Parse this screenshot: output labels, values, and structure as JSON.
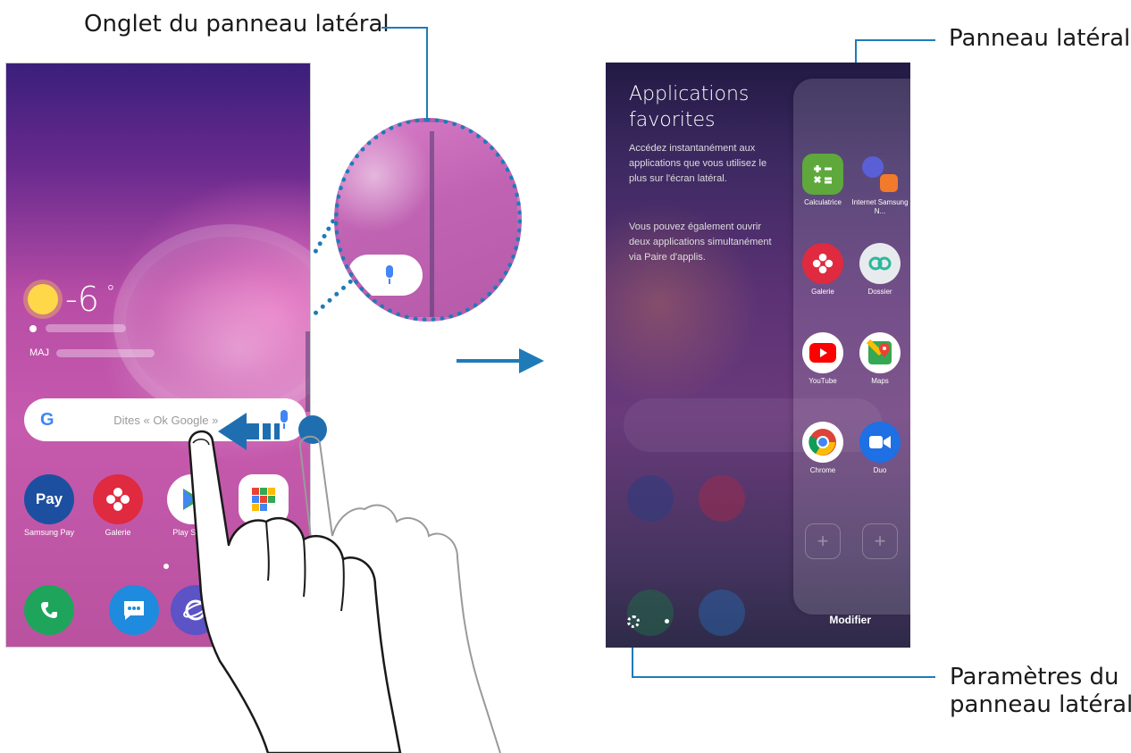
{
  "callouts": {
    "onglet": "Onglet du panneau latéral",
    "panneau": "Panneau latéral",
    "parametres_l1": "Paramètres du",
    "parametres_l2": "panneau latéral"
  },
  "left_phone": {
    "temperature": "-6",
    "degree": "°",
    "update_label": "MAJ",
    "search_placeholder": "Dites « Ok Google »",
    "apps": [
      {
        "name": "Samsung Pay",
        "icon": "Pay",
        "color": "#1d4fa0"
      },
      {
        "name": "Galerie",
        "icon": "gallery-icon",
        "color": "#e02a3f"
      },
      {
        "name": "Play Store",
        "icon": "play-store-icon",
        "color": "#ffffff"
      },
      {
        "name": "",
        "icon": "google-folder-icon",
        "color": "#ffffff"
      }
    ],
    "dock": [
      {
        "icon": "phone-icon",
        "color": "#1ea55b"
      },
      {
        "icon": "messages-icon",
        "color": "#1f8bde"
      },
      {
        "icon": "internet-icon",
        "color": "#5b53c6"
      }
    ]
  },
  "right_phone": {
    "title": "Applications\nfavorites",
    "desc1": "Accédez instantanément aux applications que vous utilisez le plus sur l'écran latéral.",
    "desc2": "Vous pouvez également ouvrir deux applications simultanément via Paire d'applis.",
    "panel_apps": [
      {
        "label": "Calculatrice",
        "icon": "calculator-icon",
        "color": "#5ea83c"
      },
      {
        "label": "Internet Samsung N...",
        "icon": "internet-notes-icon",
        "color": "#5a5fd6"
      },
      {
        "label": "Galerie",
        "icon": "gallery-icon",
        "color": "#e02a3f"
      },
      {
        "label": "Dossier",
        "icon": "folder-icon",
        "color": "#e7ebee"
      },
      {
        "label": "YouTube",
        "icon": "youtube-icon",
        "color": "#ffffff"
      },
      {
        "label": "Maps",
        "icon": "maps-icon",
        "color": "#ffffff"
      },
      {
        "label": "Chrome",
        "icon": "chrome-icon",
        "color": "#ffffff"
      },
      {
        "label": "Duo",
        "icon": "duo-icon",
        "color": "#1f6fe5"
      }
    ],
    "add_symbol": "+",
    "modify_label": "Modifier"
  },
  "colors": {
    "accent_blue": "#1f7bb8"
  }
}
